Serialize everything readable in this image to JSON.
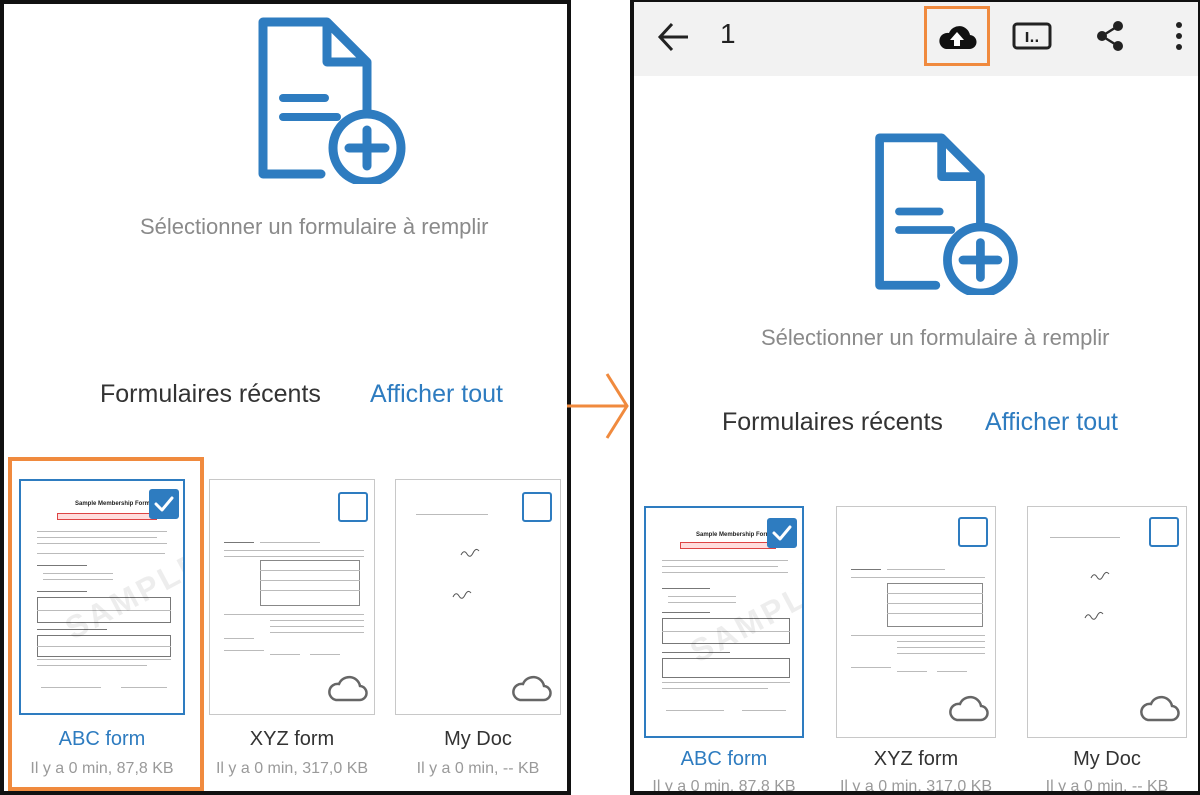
{
  "prompt": "Sélectionner un formulaire à remplir",
  "recent_label": "Formulaires récents",
  "show_all": "Afficher tout",
  "toolbar": {
    "count": "1",
    "text_icon_label": "I.."
  },
  "forms": [
    {
      "title": "ABC form",
      "meta": "Il y a 0 min, 87,8 KB",
      "selected": true,
      "thumb_heading": "Sample Membership Form",
      "watermark": "SAMPLE"
    },
    {
      "title": "XYZ form",
      "meta": "Il y a 0 min, 317,0 KB",
      "selected": false,
      "thumb_heading": ""
    },
    {
      "title": "My Doc",
      "meta": "Il y a 0 min, -- KB",
      "selected": false,
      "thumb_heading": ""
    }
  ],
  "colors": {
    "accent": "#2e7cc0",
    "highlight": "#f08a3e",
    "appbar_bg": "#f2f2f2"
  },
  "icons": {
    "back": "arrow-left-icon",
    "upload": "cloud-upload-icon",
    "text": "text-recognition-icon",
    "share": "share-icon",
    "more": "more-vertical-icon",
    "doc_plus": "document-add-icon",
    "cloud": "cloud-icon",
    "check": "checkbox-icon"
  }
}
